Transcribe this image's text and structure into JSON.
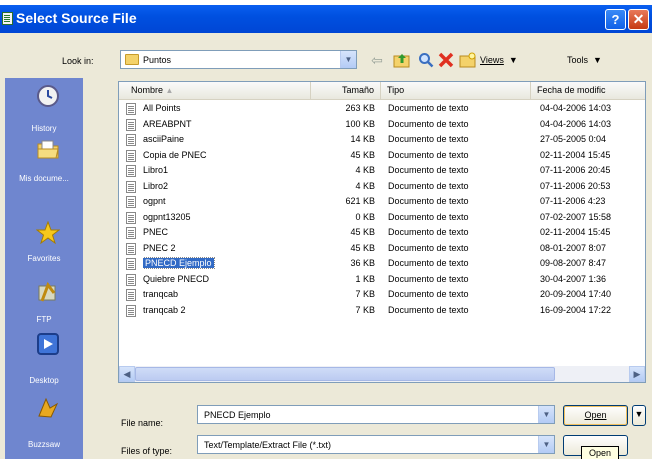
{
  "window": {
    "title": "Select Source File",
    "help": "?",
    "close": "✕"
  },
  "toolbar": {
    "look_in_label": "Look in:",
    "look_in_value": "Puntos",
    "views_label": "Views",
    "tools_label": "Tools",
    "icons": [
      "back-icon",
      "up-folder-icon",
      "search-icon",
      "delete-icon",
      "new-folder-icon"
    ]
  },
  "places": [
    {
      "label": "History",
      "icon": "history-icon"
    },
    {
      "label": "Mis docume...",
      "icon": "my-documents-icon"
    },
    {
      "label": "Favorites",
      "icon": "favorites-icon"
    },
    {
      "label": "FTP",
      "icon": "ftp-icon"
    },
    {
      "label": "Desktop",
      "icon": "desktop-icon"
    },
    {
      "label": "Buzzsaw",
      "icon": "buzzsaw-icon"
    }
  ],
  "columns": {
    "name": "Nombre",
    "size": "Tamaño",
    "type": "Tipo",
    "date": "Fecha de modific"
  },
  "files": [
    {
      "name": "All Points",
      "size": "263 KB",
      "type": "Documento de texto",
      "date": "04-04-2006 14:03"
    },
    {
      "name": "AREABPNT",
      "size": "100 KB",
      "type": "Documento de texto",
      "date": "04-04-2006 14:03"
    },
    {
      "name": "asciiPaine",
      "size": "14 KB",
      "type": "Documento de texto",
      "date": "27-05-2005 0:04"
    },
    {
      "name": "Copia de PNEC",
      "size": "45 KB",
      "type": "Documento de texto",
      "date": "02-11-2004 15:45"
    },
    {
      "name": "Libro1",
      "size": "4 KB",
      "type": "Documento de texto",
      "date": "07-11-2006 20:45"
    },
    {
      "name": "Libro2",
      "size": "4 KB",
      "type": "Documento de texto",
      "date": "07-11-2006 20:53"
    },
    {
      "name": "ogpnt",
      "size": "621 KB",
      "type": "Documento de texto",
      "date": "07-11-2006 4:23"
    },
    {
      "name": "ogpnt13205",
      "size": "0 KB",
      "type": "Documento de texto",
      "date": "07-02-2007 15:58"
    },
    {
      "name": "PNEC",
      "size": "45 KB",
      "type": "Documento de texto",
      "date": "02-11-2004 15:45"
    },
    {
      "name": "PNEC 2",
      "size": "45 KB",
      "type": "Documento de texto",
      "date": "08-01-2007 8:07"
    },
    {
      "name": "PNECD Ejemplo",
      "size": "36 KB",
      "type": "Documento de texto",
      "date": "09-08-2007 8:47"
    },
    {
      "name": "Quiebre PNECD",
      "size": "1 KB",
      "type": "Documento de texto",
      "date": "30-04-2007 1:36"
    },
    {
      "name": "tranqcab",
      "size": "7 KB",
      "type": "Documento de texto",
      "date": "20-09-2004 17:40"
    },
    {
      "name": "tranqcab 2",
      "size": "7 KB",
      "type": "Documento de texto",
      "date": "16-09-2004 17:22"
    }
  ],
  "selected_index": 10,
  "form": {
    "file_name_label": "File name:",
    "file_name_value": "PNECD Ejemplo",
    "file_type_label": "Files of type:",
    "file_type_value": "Text/Template/Extract File (*.txt)",
    "open_label": "Open",
    "tooltip": "Open"
  }
}
